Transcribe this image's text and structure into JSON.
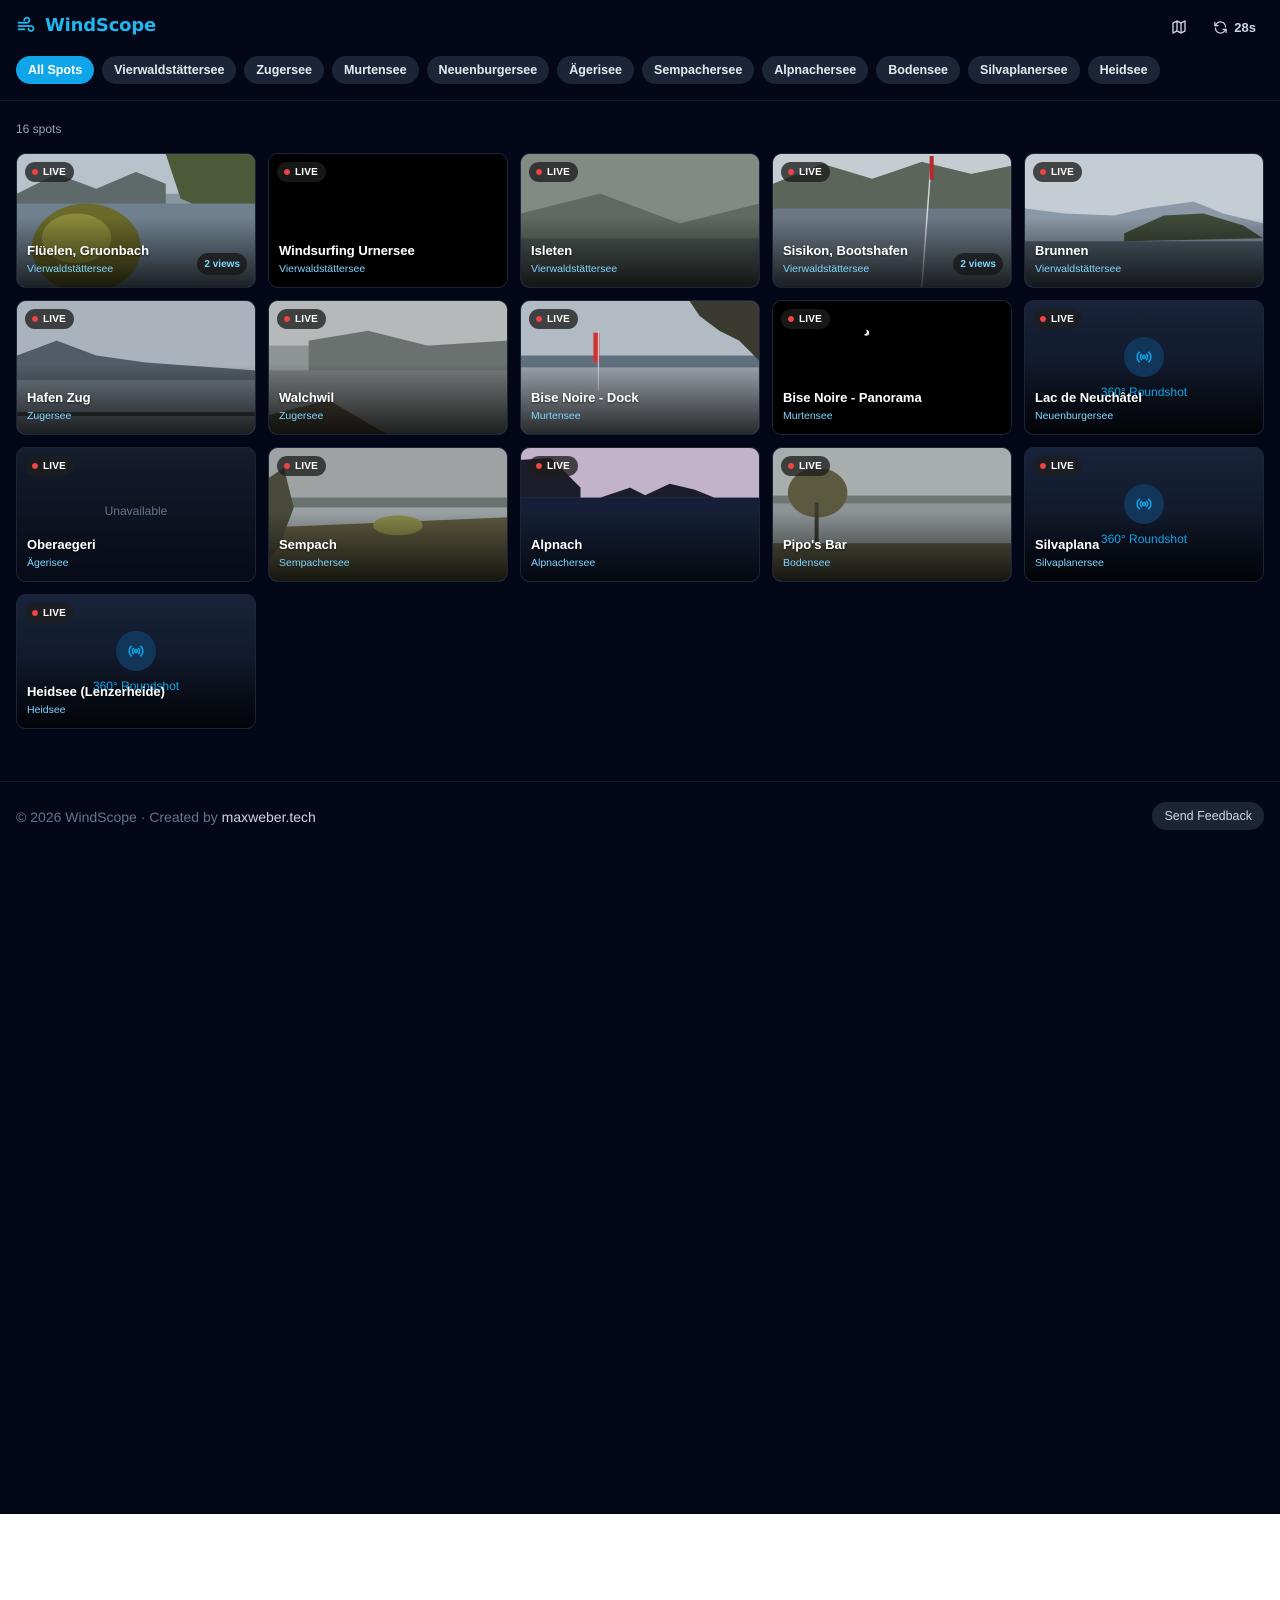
{
  "app": {
    "title": "WindScope",
    "refresh_countdown": "28s",
    "accent": "#22b6ee"
  },
  "filters": [
    "All Spots",
    "Vierwaldstättersee",
    "Zugersee",
    "Murtensee",
    "Neuenburgersee",
    "Ägerisee",
    "Sempachersee",
    "Alpnachersee",
    "Bodensee",
    "Silvaplanersee",
    "Heidsee"
  ],
  "active_filter": "All Spots",
  "spot_count": "16 spots",
  "live_label": "LIVE",
  "unavailable_label": "Unavailable",
  "roundshot_label": "360° Roundshot",
  "cards": [
    {
      "name": "Flüelen, Gruonbach",
      "lake": "Vierwaldstättersee",
      "views": "2 views"
    },
    {
      "name": "Windsurfing Urnersee",
      "lake": "Vierwaldstättersee"
    },
    {
      "name": "Isleten",
      "lake": "Vierwaldstättersee"
    },
    {
      "name": "Sisikon, Bootshafen",
      "lake": "Vierwaldstättersee",
      "views": "2 views"
    },
    {
      "name": "Brunnen",
      "lake": "Vierwaldstättersee"
    },
    {
      "name": "Hafen Zug",
      "lake": "Zugersee"
    },
    {
      "name": "Walchwil",
      "lake": "Zugersee"
    },
    {
      "name": "Bise Noire - Dock",
      "lake": "Murtensee"
    },
    {
      "name": "Bise Noire - Panorama",
      "lake": "Murtensee"
    },
    {
      "name": "Lac de Neuchâtel",
      "lake": "Neuenburgersee"
    },
    {
      "name": "Oberaegeri",
      "lake": "Ägerisee"
    },
    {
      "name": "Sempach",
      "lake": "Sempachersee"
    },
    {
      "name": "Alpnach",
      "lake": "Alpnachersee"
    },
    {
      "name": "Pipo's Bar",
      "lake": "Bodensee"
    },
    {
      "name": "Silvaplana",
      "lake": "Silvaplanersee"
    },
    {
      "name": "Heidsee (Lenzerheide)",
      "lake": "Heidsee"
    }
  ],
  "footer": {
    "copyright": "© 2026 WindScope · Created by",
    "author": "maxweber.tech",
    "feedback": "Send Feedback"
  }
}
